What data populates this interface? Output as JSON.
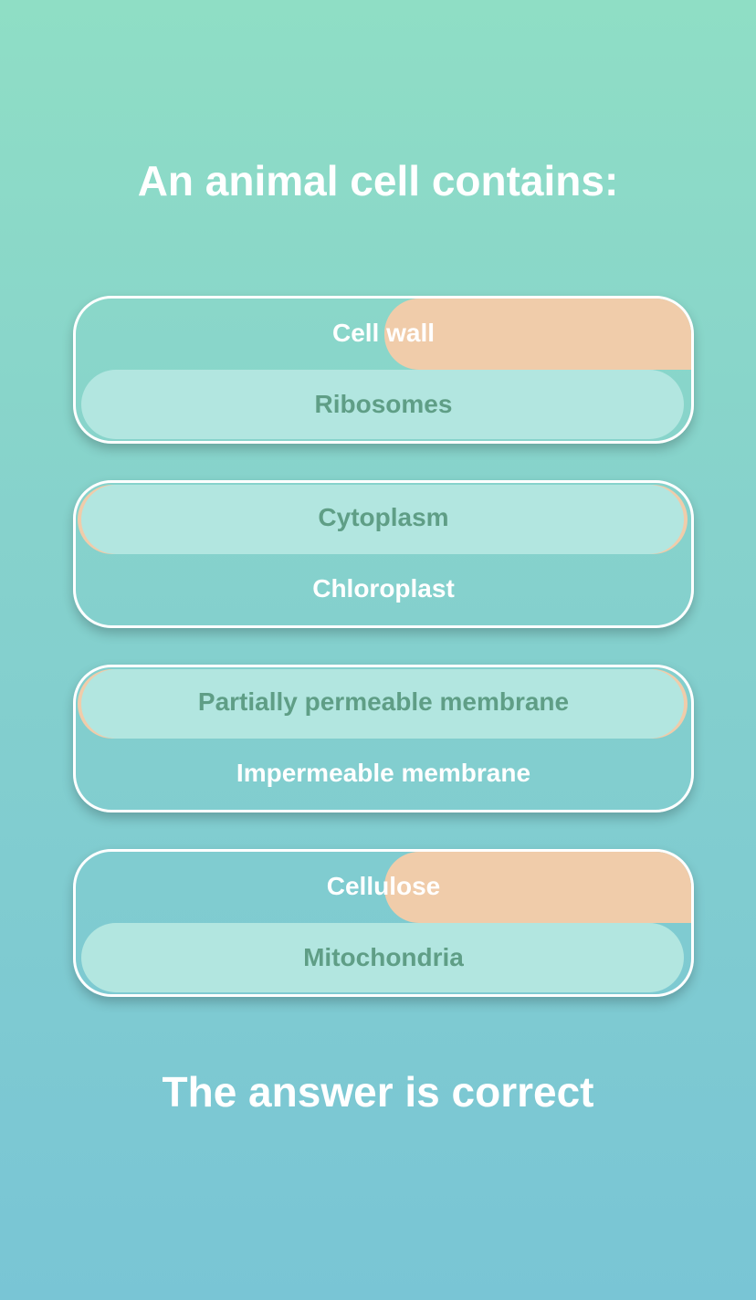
{
  "question": "An animal cell contains:",
  "pairs": [
    {
      "top": {
        "label": "Cell wall",
        "selected": false
      },
      "bottom": {
        "label": "Ribosomes",
        "selected": true
      }
    },
    {
      "top": {
        "label": "Cytoplasm",
        "selected": true
      },
      "bottom": {
        "label": "Chloroplast",
        "selected": false
      }
    },
    {
      "top": {
        "label": "Partially permeable membrane",
        "selected": true
      },
      "bottom": {
        "label": "Impermeable membrane",
        "selected": false
      }
    },
    {
      "top": {
        "label": "Cellulose",
        "selected": false
      },
      "bottom": {
        "label": "Mitochondria",
        "selected": true
      }
    }
  ],
  "result": "The answer is correct",
  "colors": {
    "background_top": "#8fdec5",
    "background_bottom": "#79c5d5",
    "selected_pill": "#b2e6e0",
    "selected_text": "#5f9e86",
    "accent_orange": "#f0ccaa"
  }
}
